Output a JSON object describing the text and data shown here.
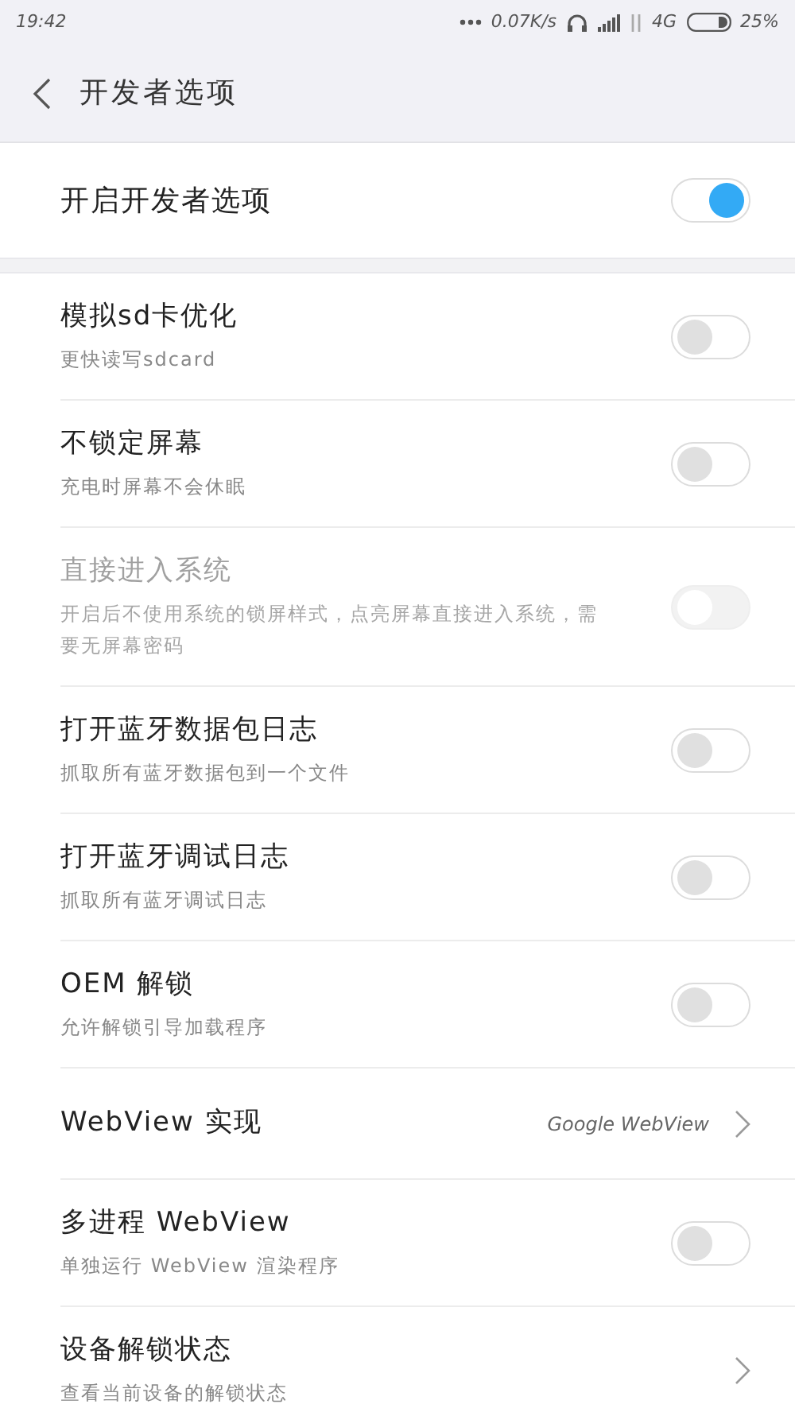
{
  "status_bar": {
    "time": "19:42",
    "speed": "0.07K/s",
    "network": "4G",
    "battery": "25%"
  },
  "header": {
    "title": "开发者选项"
  },
  "master": {
    "label": "开启开发者选项",
    "on": true
  },
  "items": [
    {
      "kind": "toggle",
      "title": "模拟sd卡优化",
      "subtitle": "更快读写sdcard",
      "on": false,
      "disabled": false
    },
    {
      "kind": "toggle",
      "title": "不锁定屏幕",
      "subtitle": "充电时屏幕不会休眠",
      "on": false,
      "disabled": false
    },
    {
      "kind": "toggle",
      "title": "直接进入系统",
      "subtitle": "开启后不使用系统的锁屏样式，点亮屏幕直接进入系统，需要无屏幕密码",
      "on": false,
      "disabled": true
    },
    {
      "kind": "toggle",
      "title": "打开蓝牙数据包日志",
      "subtitle": "抓取所有蓝牙数据包到一个文件",
      "on": false,
      "disabled": false
    },
    {
      "kind": "toggle",
      "title": "打开蓝牙调试日志",
      "subtitle": "抓取所有蓝牙调试日志",
      "on": false,
      "disabled": false
    },
    {
      "kind": "toggle",
      "title": "OEM 解锁",
      "subtitle": "允许解锁引导加载程序",
      "on": false,
      "disabled": false
    },
    {
      "kind": "link",
      "title": "WebView 实现",
      "value": "Google WebView"
    },
    {
      "kind": "toggle",
      "title": "多进程 WebView",
      "subtitle": "单独运行 WebView 渲染程序",
      "on": false,
      "disabled": false
    },
    {
      "kind": "link",
      "title": "设备解锁状态",
      "subtitle": "查看当前设备的解锁状态"
    }
  ]
}
